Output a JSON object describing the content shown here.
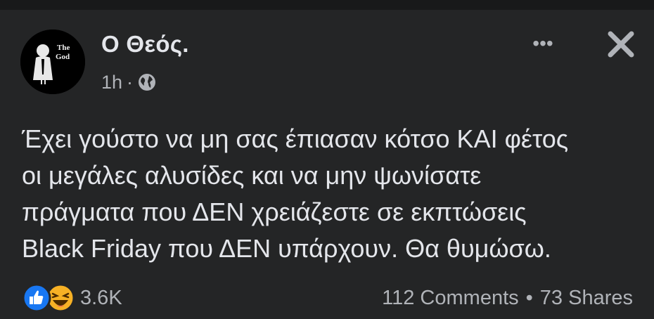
{
  "post": {
    "author": "Ο Θεός.",
    "avatar_icon": "godfather-logo-avatar",
    "avatar_text": [
      "The",
      "God"
    ],
    "time": "1h",
    "separator": "·",
    "privacy_icon": "globe-icon",
    "more_icon": "more-options-icon",
    "more_label": "•••",
    "close_icon": "close-icon",
    "text": "Έχει γούστο να μη σας έπιασαν κότσο ΚΑΙ φέτος\nοι μεγάλες αλυσίδες και να μην ψωνίσατε\nπράγματα που ΔΕΝ χρειάζεστε σε εκπτώσεις\nBlack Friday που ΔΕΝ υπάρχουν. Θα θυμώσω."
  },
  "footer": {
    "reaction_icons": [
      "like-icon",
      "haha-icon"
    ],
    "reaction_count": "3.6K",
    "comments": "112 Comments",
    "dot": "•",
    "shares": "73 Shares"
  },
  "colors": {
    "background": "#242526",
    "text_primary": "#e4e6eb",
    "text_secondary": "#b0b3b8",
    "like_blue": "#1877f2",
    "haha_yellow": "#f7b125"
  }
}
